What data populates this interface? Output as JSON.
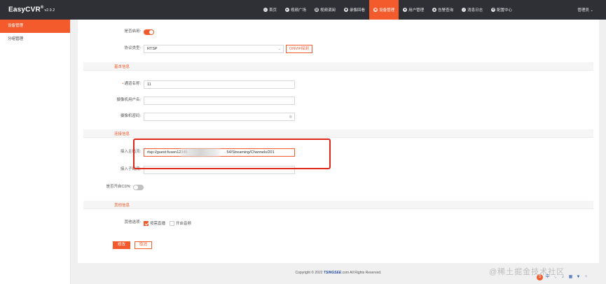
{
  "brand": {
    "name": "EasyCVR",
    "reg": "®",
    "version": "v2.0.2"
  },
  "nav": [
    {
      "label": "首页",
      "icon": "home-icon",
      "glyph": "⌂"
    },
    {
      "label": "视频广场",
      "icon": "play-icon",
      "glyph": "▸"
    },
    {
      "label": "视频调阅",
      "icon": "grid-icon",
      "glyph": "▦"
    },
    {
      "label": "录像回看",
      "icon": "video-icon",
      "glyph": "■"
    },
    {
      "label": "设备管理",
      "icon": "device-icon",
      "glyph": "▣",
      "active": true
    },
    {
      "label": "用户管理",
      "icon": "user-icon",
      "glyph": "●"
    },
    {
      "label": "告警查询",
      "icon": "alarm-icon",
      "glyph": "▲"
    },
    {
      "label": "消息日志",
      "icon": "bell-icon",
      "glyph": "♪"
    },
    {
      "label": "配置中心",
      "icon": "gear-icon",
      "glyph": "✲"
    }
  ],
  "user": {
    "label": "管理员",
    "caret": "⌄"
  },
  "sidebar": {
    "items": [
      {
        "label": "设备管理",
        "active": true
      },
      {
        "label": "分组管理"
      }
    ]
  },
  "form": {
    "enabled_label": "是否启用:",
    "protocol_label": "协议类型:",
    "protocol_value": "RTSP",
    "onvif_button": "ONVIF探测",
    "section_basic": "基本信息",
    "channel_name_label": "通道名称:",
    "channel_name_value": "11",
    "camera_user_label": "摄像机用户名:",
    "camera_password_label": "摄像机密码:",
    "section_connect": "连接信息",
    "main_stream_label": "接入主码流:",
    "main_stream_value": "rtsp://guest:fusen12345",
    "main_stream_suffix": "54/Streaming/Channels/201",
    "sub_stream_label": "接入子码流:",
    "cdn_label": "是否开启CDN:",
    "section_other": "其他信息",
    "other_options_label": "其他选项:",
    "option_ondemand": "按需直播",
    "option_audio": "开启音频",
    "save_button": "修改",
    "cancel_button": "取消"
  },
  "footer": {
    "prefix": "Copyright © 2022",
    "brand": "TSINGSEE",
    "suffix": ".com All Rights Reserved."
  },
  "watermark": "@稀土掘金技术社区",
  "colors": {
    "accent": "#f35b2d",
    "topbar": "#2f3036",
    "annotation": "#e0261b"
  }
}
